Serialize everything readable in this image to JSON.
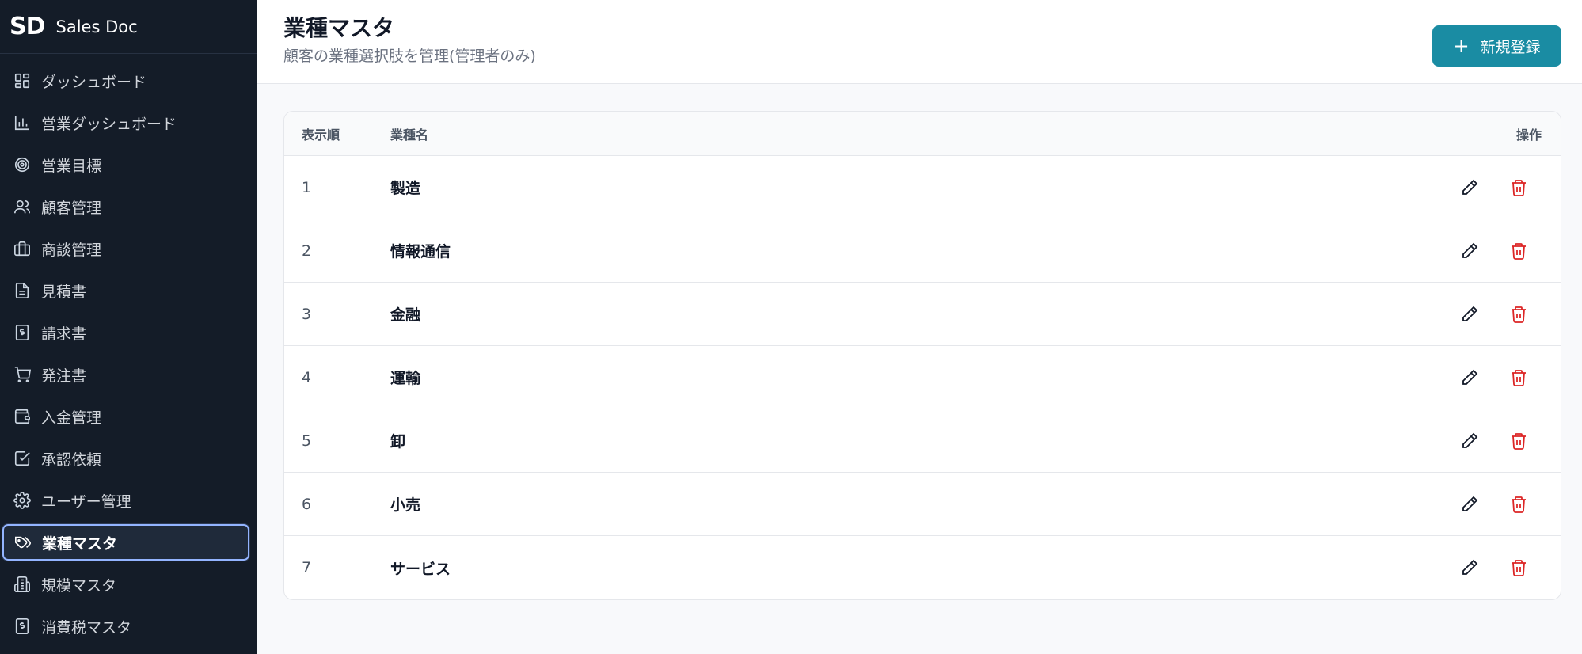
{
  "brand": {
    "logo": "SD",
    "name": "Sales Doc"
  },
  "sidebar": {
    "items": [
      {
        "label": "ダッシュボード",
        "icon": "grid-icon"
      },
      {
        "label": "営業ダッシュボード",
        "icon": "bar-chart-icon"
      },
      {
        "label": "営業目標",
        "icon": "target-icon"
      },
      {
        "label": "顧客管理",
        "icon": "users-icon"
      },
      {
        "label": "商談管理",
        "icon": "briefcase-icon"
      },
      {
        "label": "見積書",
        "icon": "document-icon"
      },
      {
        "label": "請求書",
        "icon": "invoice-icon"
      },
      {
        "label": "発注書",
        "icon": "cart-icon"
      },
      {
        "label": "入金管理",
        "icon": "wallet-icon"
      },
      {
        "label": "承認依頼",
        "icon": "check-square-icon"
      },
      {
        "label": "ユーザー管理",
        "icon": "gear-icon"
      },
      {
        "label": "業種マスタ",
        "icon": "tag-icon",
        "active": true
      },
      {
        "label": "規模マスタ",
        "icon": "building-icon"
      },
      {
        "label": "消費税マスタ",
        "icon": "receipt-icon"
      }
    ]
  },
  "header": {
    "title": "業種マスタ",
    "subtitle": "顧客の業種選択肢を管理(管理者のみ)",
    "new_button_label": "新規登録"
  },
  "table": {
    "columns": {
      "order": "表示順",
      "name": "業種名",
      "actions": "操作"
    },
    "rows": [
      {
        "order": "1",
        "name": "製造"
      },
      {
        "order": "2",
        "name": "情報通信"
      },
      {
        "order": "3",
        "name": "金融"
      },
      {
        "order": "4",
        "name": "運輸"
      },
      {
        "order": "5",
        "name": "卸"
      },
      {
        "order": "6",
        "name": "小売"
      },
      {
        "order": "7",
        "name": "サービス"
      }
    ]
  },
  "colors": {
    "sidebar_bg": "#141c28",
    "accent": "#1a8ca3",
    "delete": "#dc2626",
    "active_outline": "#93b4ff"
  }
}
